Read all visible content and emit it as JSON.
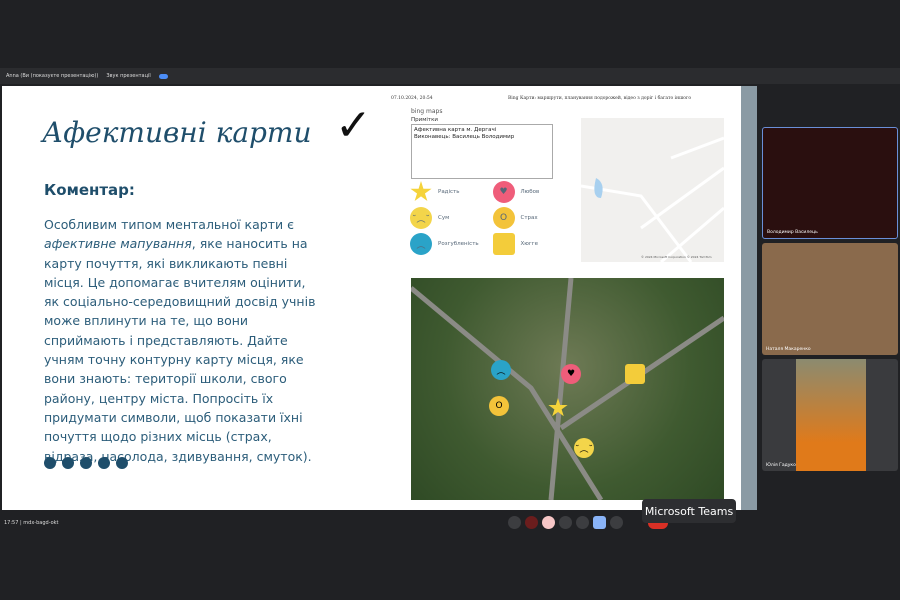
{
  "topbar": {
    "presenter": "Anna (Ви (показуєте презентацію))",
    "sound_label": "Звук презентації"
  },
  "slide": {
    "title": "Афективні карти",
    "checkmark": "✓",
    "subtitle": "Коментар:",
    "body_pre": "Особливим типом ментальної карти є ",
    "body_em": "афективне мапування",
    "body_post": ", яке наносить на карту почуття, які викликають певні місця. Це допомагає вчителям оцінити, як соціально-середовищний досвід учнів може вплинути на те, що вони сприймають і представляють. Дайте учням точну контурну карту місця, яке вони знають: території школи, свого району, центру міста. Попросіть їх придумати символи, щоб показати їхні почуття щодо різних місць (страх, відраза, насолода, здивування, смуток)."
  },
  "page": {
    "date": "07.10.2024, 20:54",
    "header": "Bing Карти: маршрути, планування подорожей, відео з дорiг i багато іншого",
    "brand": "bing maps",
    "notes_label": "Примітки",
    "notes": [
      "Афективна карта м. Дергачі",
      "Виконавець: Василець Володимир"
    ],
    "legend": [
      {
        "label": "Радість",
        "icon": "star-smile",
        "color": "#f5d33b"
      },
      {
        "label": "Любов",
        "icon": "heart-smile",
        "color": "#ef5d7a"
      },
      {
        "label": "Сум",
        "icon": "sad-face",
        "color": "#f3d54a"
      },
      {
        "label": "Страх",
        "icon": "scream-face",
        "color": "#f3c33a"
      },
      {
        "label": "Розгубленість",
        "icon": "confused-face",
        "color": "#2aa3c8"
      },
      {
        "label": "Хюгге",
        "icon": "pillow",
        "color": "#f3cc3a"
      }
    ],
    "map_copyright": "© 2024 Microsoft Corporation © 2024 TomTom"
  },
  "participants": [
    {
      "name": "Володимир Василець"
    },
    {
      "name": "Наталя Макаренко"
    },
    {
      "name": "Юлія Гадуко"
    }
  ],
  "bottom": {
    "time": "17:57",
    "meeting_code": "mdx-bagd-okt"
  },
  "tooltip": "Microsoft Teams"
}
